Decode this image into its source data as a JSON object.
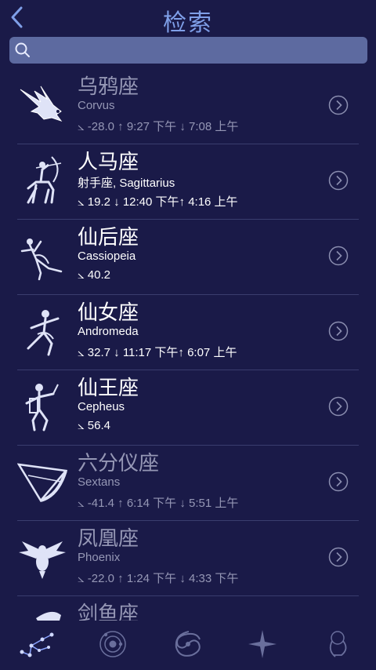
{
  "header": {
    "title": "检索",
    "back_icon": "back-arrow-icon"
  },
  "search": {
    "placeholder": "",
    "value": "",
    "icon": "search-icon"
  },
  "constellations": [
    {
      "name": "乌鸦座",
      "subtitle": "Corvus",
      "info": "⦣ -28.0  ↑ 9:27 下午  ↓ 7:08 上午",
      "visible": false,
      "icon": "corvus-icon"
    },
    {
      "name": "人马座",
      "subtitle": "射手座, Sagittarius",
      "info": "⦣ 19.2  ↓ 12:40 下午↑ 4:16 上午",
      "visible": true,
      "icon": "sagittarius-icon"
    },
    {
      "name": "仙后座",
      "subtitle": "Cassiopeia",
      "info": "⦣ 40.2",
      "visible": true,
      "icon": "cassiopeia-icon"
    },
    {
      "name": "仙女座",
      "subtitle": "Andromeda",
      "info": "⦣ 32.7  ↓ 11:17 下午↑ 6:07 上午",
      "visible": true,
      "icon": "andromeda-icon"
    },
    {
      "name": "仙王座",
      "subtitle": "Cepheus",
      "info": "⦣ 56.4",
      "visible": true,
      "icon": "cepheus-icon"
    },
    {
      "name": "六分仪座",
      "subtitle": "Sextans",
      "info": "⦣ -41.4  ↑ 6:14 下午  ↓ 5:51 上午",
      "visible": false,
      "icon": "sextans-icon"
    },
    {
      "name": "凤凰座",
      "subtitle": "Phoenix",
      "info": "⦣ -22.0  ↑ 1:24 下午  ↓ 4:33 下午",
      "visible": false,
      "icon": "phoenix-icon"
    },
    {
      "name": "剑鱼座",
      "subtitle": "",
      "info": "",
      "visible": false,
      "icon": "dorado-icon"
    }
  ],
  "tabs": [
    {
      "icon": "constellation-tab-icon",
      "active": true
    },
    {
      "icon": "solar-system-tab-icon",
      "active": false
    },
    {
      "icon": "galaxy-tab-icon",
      "active": false
    },
    {
      "icon": "star-tab-icon",
      "active": false
    },
    {
      "icon": "zodiac-tab-icon",
      "active": false
    }
  ],
  "colors": {
    "background": "#1a1a48",
    "title": "#7f9fe8",
    "search": "#5d6aa0",
    "dim_text": "#9597b5"
  }
}
